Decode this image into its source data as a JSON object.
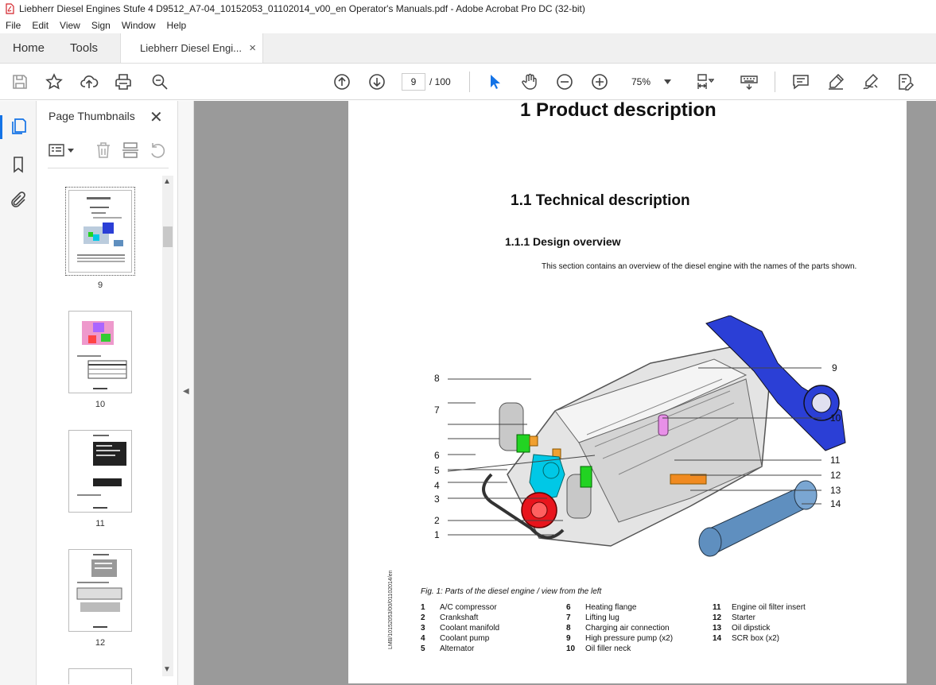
{
  "window": {
    "title": "Liebherr Diesel Engines Stufe 4 D9512_A7-04_10152053_01102014_v00_en Operator's Manuals.pdf - Adobe Acrobat Pro DC (32-bit)"
  },
  "menu": [
    "File",
    "Edit",
    "View",
    "Sign",
    "Window",
    "Help"
  ],
  "tabs": {
    "home": "Home",
    "tools": "Tools",
    "document": "Liebherr Diesel Engi...",
    "close": "×"
  },
  "toolbar": {
    "page_current": "9",
    "page_total": "/ 100",
    "zoom": "75%"
  },
  "panel": {
    "title": "Page Thumbnails",
    "close": "✕"
  },
  "thumbnails": [
    {
      "label": "9",
      "selected": true
    },
    {
      "label": "10"
    },
    {
      "label": "11"
    },
    {
      "label": "12"
    }
  ],
  "doc": {
    "h1": "1  Product description",
    "h2": "1.1  Technical description",
    "h3": "1.1.1   Design overview",
    "intro": "This section contains an overview of the diesel engine with the names of the parts shown.",
    "caption": "Fig. 1: Parts of the diesel engine / view from the left",
    "side_code": "LMB/10152053/00/01102014/en",
    "labels": [
      "1",
      "2",
      "3",
      "4",
      "5",
      "6",
      "7",
      "8",
      "9",
      "10",
      "11",
      "12",
      "13",
      "14"
    ],
    "legend": [
      {
        "n": "1",
        "t": "A/C compressor"
      },
      {
        "n": "2",
        "t": "Crankshaft"
      },
      {
        "n": "3",
        "t": "Coolant manifold"
      },
      {
        "n": "4",
        "t": "Coolant pump"
      },
      {
        "n": "5",
        "t": "Alternator"
      },
      {
        "n": "6",
        "t": "Heating flange"
      },
      {
        "n": "7",
        "t": "Lifting lug"
      },
      {
        "n": "8",
        "t": "Charging air connection"
      },
      {
        "n": "9",
        "t": "High pressure pump (x2)"
      },
      {
        "n": "10",
        "t": "Oil filler neck"
      },
      {
        "n": "11",
        "t": "Engine oil filter insert"
      },
      {
        "n": "12",
        "t": "Starter"
      },
      {
        "n": "13",
        "t": "Oil dipstick"
      },
      {
        "n": "14",
        "t": "SCR box (x2)"
      }
    ]
  },
  "colors": {
    "accent": "#1473e6",
    "engine_blue": "#2b3fd6",
    "pump_cyan": "#00c8e6",
    "green": "#22d322",
    "scr_box": "#5f8fbf"
  }
}
